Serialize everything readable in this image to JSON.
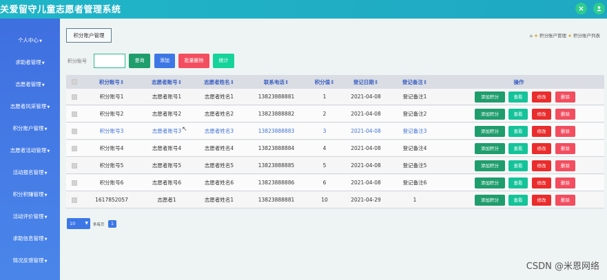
{
  "app": {
    "title": "关爱留守儿童志愿者管理系统"
  },
  "header_icons": [
    "settings-icon",
    "user-icon"
  ],
  "sidebar": {
    "items": [
      {
        "label": "个人中心"
      },
      {
        "label": "求助者管理"
      },
      {
        "label": "志愿者管理"
      },
      {
        "label": "志愿者风采管理"
      },
      {
        "label": "积分账户管理"
      },
      {
        "label": "志愿者活动管理"
      },
      {
        "label": "活动报名管理"
      },
      {
        "label": "积分积赚管理"
      },
      {
        "label": "活动评价管理"
      },
      {
        "label": "求助信息管理"
      },
      {
        "label": "情况反馈管理"
      }
    ]
  },
  "page": {
    "tab_label": "积分账户管理",
    "breadcrumb": [
      "积分账户管理",
      "积分账户列表"
    ]
  },
  "search": {
    "label": "积分账号",
    "value": "",
    "buttons": {
      "query": "查询",
      "add": "添加",
      "batch_delete": "批量删除",
      "stats": "统计"
    }
  },
  "table": {
    "headers": [
      "积分账号",
      "志愿者账号",
      "志愿者姓名",
      "联系电话",
      "积分值",
      "登记日期",
      "登记备注",
      "操作"
    ],
    "rows": [
      [
        "积分账号1",
        "志愿者账号1",
        "志愿者姓名1",
        "13823888881",
        "1",
        "2021-04-08",
        "登记备注1"
      ],
      [
        "积分账号2",
        "志愿者账号2",
        "志愿者姓名2",
        "13823888882",
        "2",
        "2021-04-08",
        "登记备注2"
      ],
      [
        "积分账号3",
        "志愿者账号3",
        "志愿者姓名3",
        "13823888883",
        "3",
        "2021-04-08",
        "登记备注3"
      ],
      [
        "积分账号4",
        "志愿者账号4",
        "志愿者姓名4",
        "13823888884",
        "4",
        "2021-04-08",
        "登记备注4"
      ],
      [
        "积分账号5",
        "志愿者账号5",
        "志愿者姓名5",
        "13823888885",
        "5",
        "2021-04-08",
        "登记备注5"
      ],
      [
        "积分账号6",
        "志愿者账号6",
        "志愿者姓名6",
        "13823888886",
        "6",
        "2021-04-08",
        "登记备注6"
      ],
      [
        "1617852057",
        "志愿者1",
        "志愿者姓名1",
        "13823888881",
        "10",
        "2021-04-29",
        "1"
      ]
    ],
    "actions": {
      "add_points": "添加积分",
      "view": "查看",
      "edit": "修改",
      "delete": "删除"
    }
  },
  "pagination": {
    "page_size": "10",
    "per_page_label": "条每页",
    "current_page": "1"
  },
  "watermark": "CSDN @米恩网络",
  "colors": {
    "header": "#20b5c8",
    "sidebar": "#4a86ea",
    "add_points": "#1f9d6d",
    "view": "#15c39a",
    "edit": "#ea2c2c",
    "delete": "#f24e5f",
    "link_highlight": "#3f72d6"
  }
}
